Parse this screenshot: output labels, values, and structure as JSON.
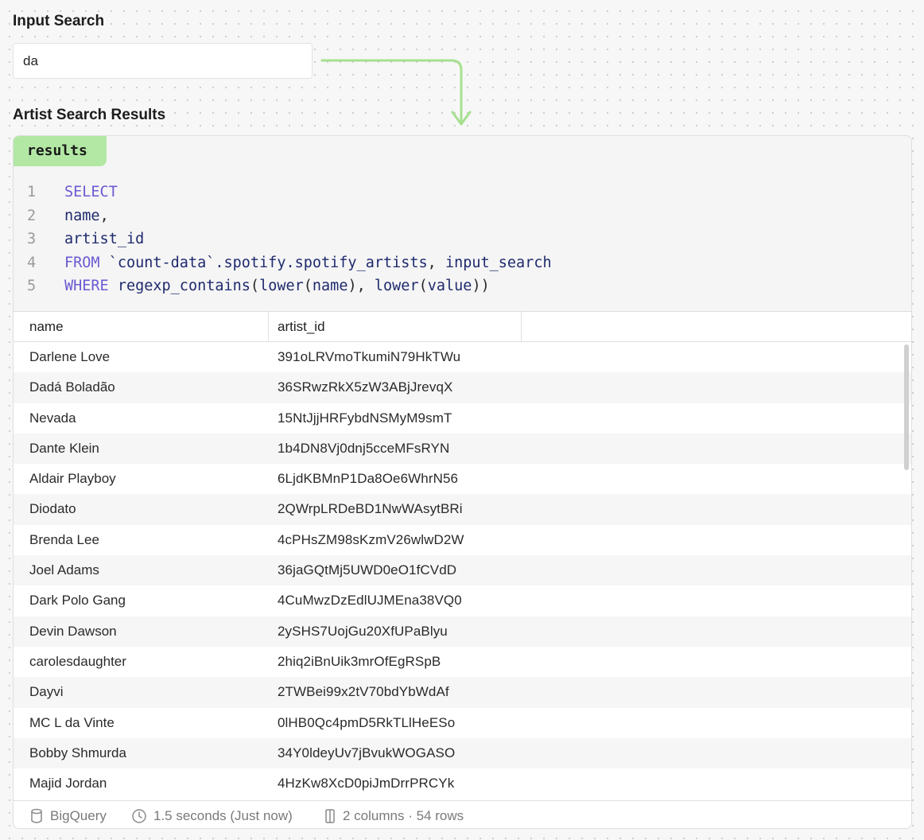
{
  "input_section": {
    "label": "Input Search",
    "value": "da"
  },
  "results_section": {
    "label": "Artist Search Results",
    "tag": "results"
  },
  "query": {
    "lines": [
      {
        "num": "1",
        "tokens": [
          {
            "t": "SELECT",
            "c": "kw"
          }
        ]
      },
      {
        "num": "2",
        "tokens": [
          {
            "t": "name",
            "c": "id"
          },
          {
            "t": ",",
            "c": "pn"
          }
        ]
      },
      {
        "num": "3",
        "tokens": [
          {
            "t": "artist_id",
            "c": "id"
          }
        ]
      },
      {
        "num": "4",
        "tokens": [
          {
            "t": "FROM",
            "c": "kw"
          },
          {
            "t": " `count-data`.spotify.spotify_artists",
            "c": "id"
          },
          {
            "t": ", ",
            "c": "pn"
          },
          {
            "t": "input_search",
            "c": "id"
          }
        ]
      },
      {
        "num": "5",
        "tokens": [
          {
            "t": "WHERE",
            "c": "kw"
          },
          {
            "t": " regexp_contains",
            "c": "id"
          },
          {
            "t": "(",
            "c": "pn"
          },
          {
            "t": "lower",
            "c": "id"
          },
          {
            "t": "(",
            "c": "pn"
          },
          {
            "t": "name",
            "c": "id"
          },
          {
            "t": "), ",
            "c": "pn"
          },
          {
            "t": "lower",
            "c": "id"
          },
          {
            "t": "(",
            "c": "pn"
          },
          {
            "t": "value",
            "c": "id"
          },
          {
            "t": "))",
            "c": "pn"
          }
        ]
      }
    ]
  },
  "table": {
    "columns": [
      "name",
      "artist_id"
    ],
    "rows": [
      [
        "Darlene Love",
        "391oLRVmoTkumiN79HkTWu"
      ],
      [
        "Dadá Boladão",
        "36SRwzRkX5zW3ABjJrevqX"
      ],
      [
        "Nevada",
        "15NtJjjHRFybdNSMyM9smT"
      ],
      [
        "Dante Klein",
        "1b4DN8Vj0dnj5cceMFsRYN"
      ],
      [
        "Aldair Playboy",
        "6LjdKBMnP1Da8Oe6WhrN56"
      ],
      [
        "Diodato",
        "2QWrpLRDeBD1NwWAsytBRi"
      ],
      [
        "Brenda Lee",
        "4cPHsZM98sKzmV26wlwD2W"
      ],
      [
        "Joel Adams",
        "36jaGQtMj5UWD0eO1fCVdD"
      ],
      [
        "Dark Polo Gang",
        "4CuMwzDzEdlUJMEna38VQ0"
      ],
      [
        "Devin Dawson",
        "2ySHS7UojGu20XfUPaBlyu"
      ],
      [
        "carolesdaughter",
        "2hiq2iBnUik3mrOfEgRSpB"
      ],
      [
        "Dayvi",
        "2TWBei99x2tV70bdYbWdAf"
      ],
      [
        "MC L da Vinte",
        "0lHB0Qc4pmD5RkTLlHeESo"
      ],
      [
        "Bobby Shmurda",
        "34Y0ldeyUv7jBvukWOGASO"
      ],
      [
        "Majid Jordan",
        "4HzKw8XcD0piJmDrrPRCYk"
      ]
    ]
  },
  "footer": {
    "source": "BigQuery",
    "timing": "1.5 seconds (Just now)",
    "stats": "2 columns · 54 rows",
    "icons": [
      "database-icon",
      "clock-icon",
      "columns-icon"
    ]
  },
  "colors": {
    "accent_green": "#b3e8a4",
    "arrow_green": "#a6e08f",
    "keyword": "#6a5ad2",
    "identifier": "#1f2a6e"
  }
}
